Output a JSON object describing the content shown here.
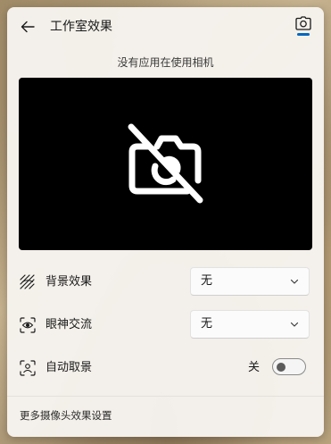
{
  "header": {
    "title": "工作室效果",
    "back_icon": "arrow-left-icon",
    "camera_icon": "camera-icon"
  },
  "status": {
    "no_camera_text": "没有应用在使用相机"
  },
  "preview": {
    "icon": "camera-off-icon"
  },
  "settings": {
    "background_effect": {
      "label": "背景效果",
      "icon": "background-blur-icon",
      "value": "无"
    },
    "eye_contact": {
      "label": "眼神交流",
      "icon": "eye-contact-icon",
      "value": "无"
    },
    "auto_framing": {
      "label": "自动取景",
      "icon": "auto-framing-icon",
      "state_label": "关",
      "enabled": false
    }
  },
  "footer": {
    "more_settings_label": "更多摄像头效果设置"
  },
  "colors": {
    "accent": "#0067c0",
    "panel_bg": "#f6f3ee",
    "preview_bg": "#000000"
  }
}
